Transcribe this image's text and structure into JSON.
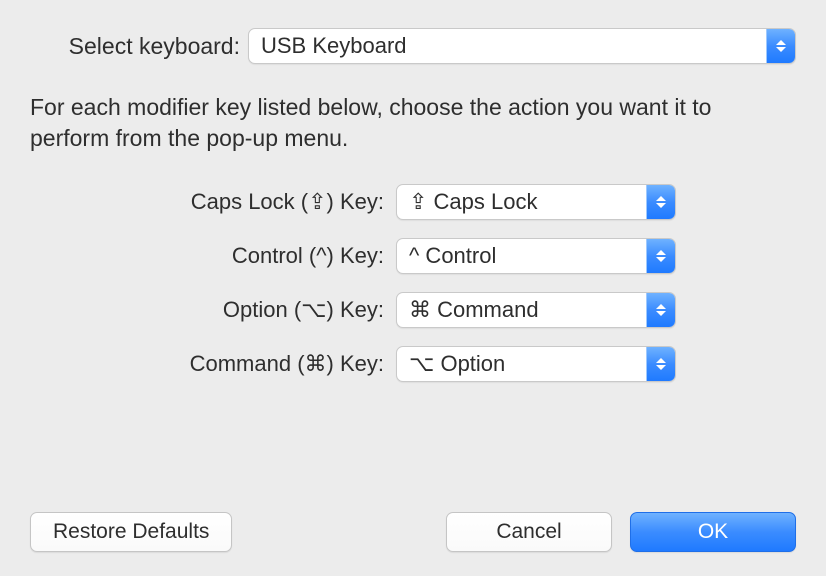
{
  "selectKeyboard": {
    "label": "Select keyboard:",
    "value": "USB Keyboard"
  },
  "description": "For each modifier key listed below, choose the action you want it to perform from the pop-up menu.",
  "modifiers": {
    "capsLock": {
      "label": "Caps Lock (⇪) Key:",
      "value": "⇪ Caps Lock"
    },
    "control": {
      "label": "Control (^) Key:",
      "value": "^ Control"
    },
    "option": {
      "label": "Option (⌥) Key:",
      "value": "⌘ Command"
    },
    "command": {
      "label": "Command (⌘) Key:",
      "value": "⌥ Option"
    }
  },
  "buttons": {
    "restoreDefaults": "Restore Defaults",
    "cancel": "Cancel",
    "ok": "OK"
  }
}
